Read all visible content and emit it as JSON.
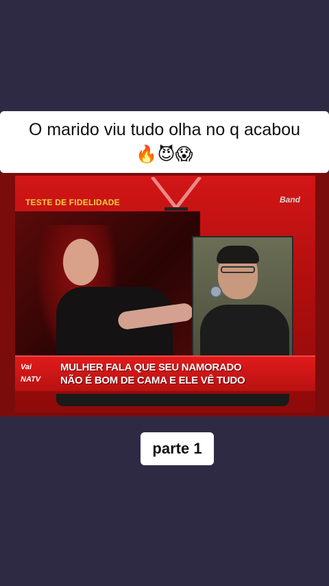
{
  "post": {
    "title": "O marido viu tudo olha no q acabou 🔥😈😱",
    "part_label": "parte 1"
  },
  "video": {
    "show_title": "TESTE DE FIDELIDADE",
    "channel_logo": "Band",
    "lower_third": {
      "logo_line1": "Vai",
      "logo_line2": "NATV",
      "headline_line1": "MULHER FALA QUE SEU NAMORADO",
      "headline_line2": "NÃO É BOM DE CAMA E ELE VÊ TUDO"
    }
  },
  "colors": {
    "background": "#2f2a44",
    "card": "#ffffff",
    "video_red": "#d21616",
    "show_title_yellow": "#f2d23b"
  }
}
